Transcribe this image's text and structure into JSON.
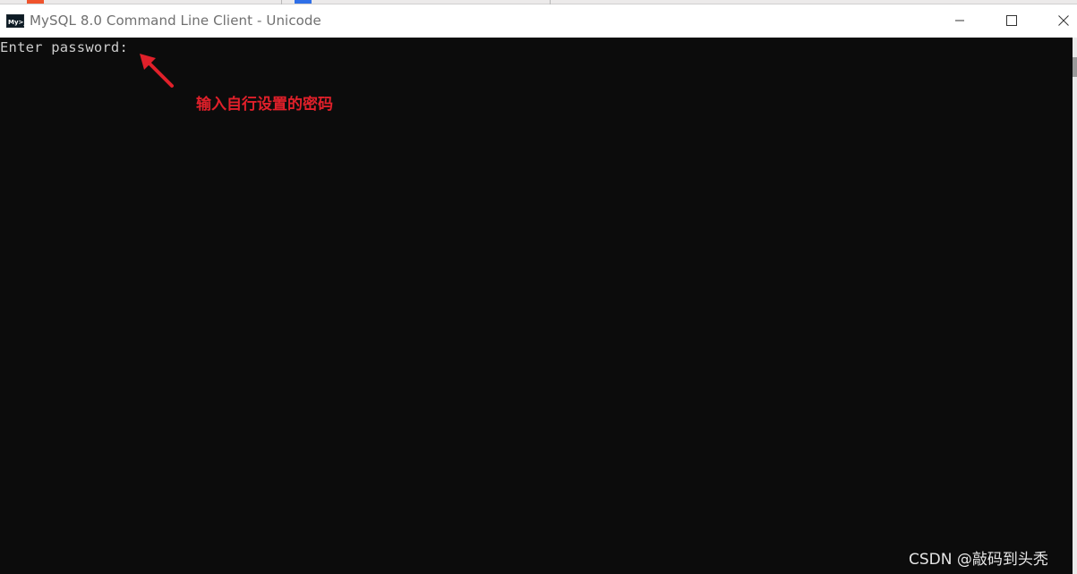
{
  "window": {
    "title": "MySQL 8.0 Command Line Client - Unicode",
    "icon": "mysql-console-icon",
    "controls": [
      "minimize-icon",
      "maximize-icon",
      "close-icon"
    ]
  },
  "console": {
    "prompt": "Enter password:",
    "background_color": "#0c0c0c",
    "text_color": "#cccccc"
  },
  "annotation": {
    "text": "输入自行设置的密码",
    "color": "#e0202a",
    "icon": "red-arrow-icon"
  },
  "watermark": {
    "text": "CSDN @敲码到头秃"
  }
}
